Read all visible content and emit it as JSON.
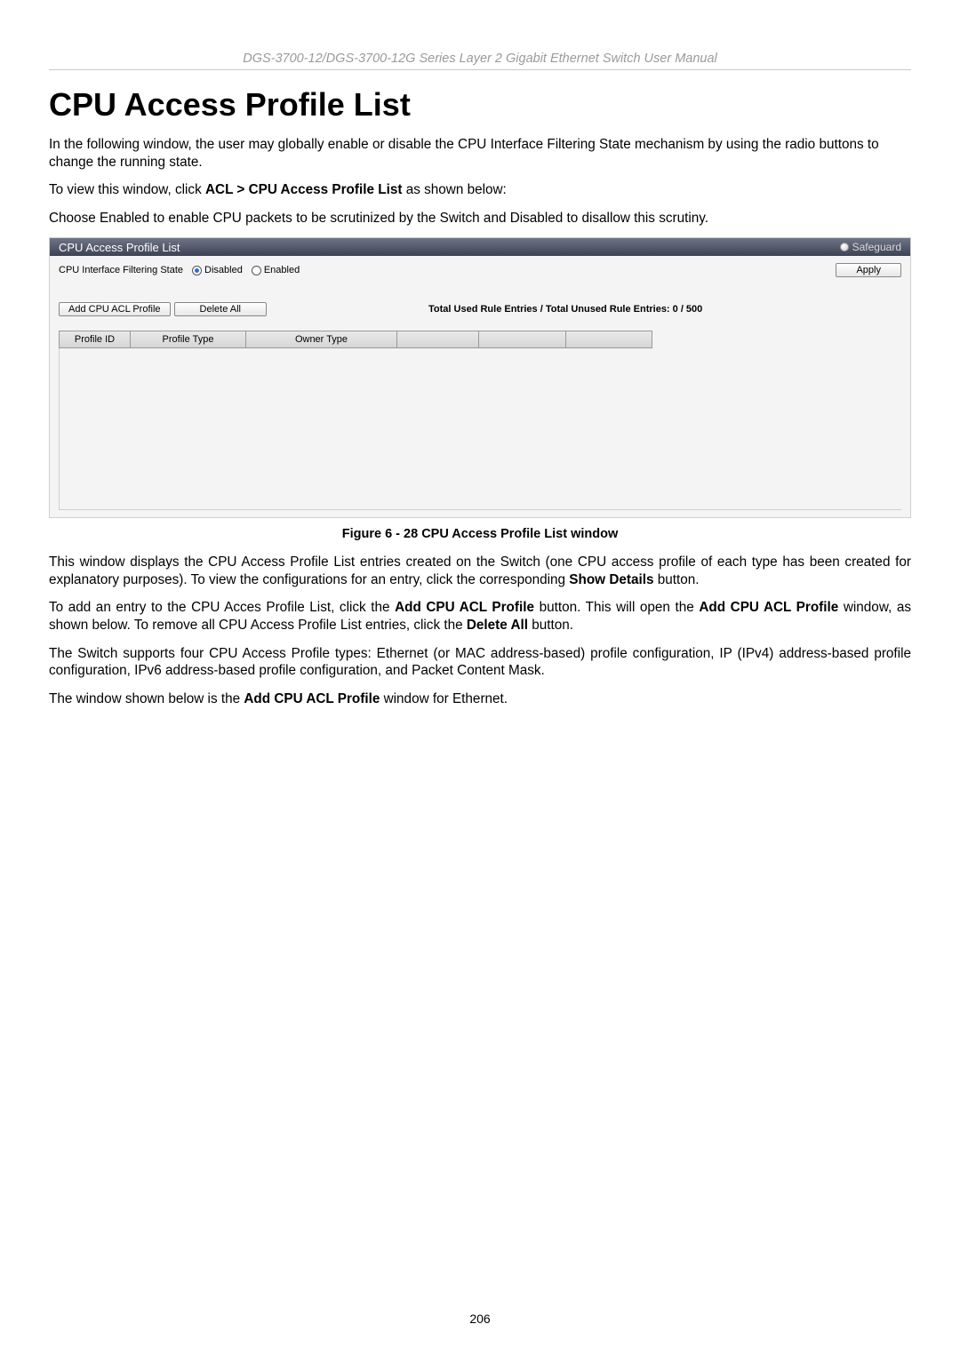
{
  "header": "DGS-3700-12/DGS-3700-12G Series Layer 2 Gigabit Ethernet Switch User Manual",
  "title": "CPU Access Profile List",
  "p1": "In the following window, the user may globally enable or disable the CPU Interface Filtering State mechanism by using the radio buttons to change the running state.",
  "p2_a": "To view this window, click ",
  "p2_b": "ACL > CPU Access Profile List",
  "p2_c": " as shown below:",
  "p3": "Choose Enabled to enable CPU packets to be scrutinized by the Switch and Disabled to disallow this scrutiny.",
  "shot": {
    "title": "CPU Access Profile List",
    "safeguard": "Safeguard",
    "filter_label": "CPU Interface Filtering State",
    "radio_disabled": "Disabled",
    "radio_enabled": "Enabled",
    "apply": "Apply",
    "btn_add": "Add CPU ACL Profile",
    "btn_del": "Delete All",
    "rule_entries": "Total Used Rule Entries / Total Unused Rule Entries: 0 / 500",
    "cols": [
      "Profile ID",
      "Profile Type",
      "Owner Type",
      "",
      "",
      ""
    ]
  },
  "caption": "Figure 6 - 28 CPU Access Profile List window",
  "p4_a": "This window displays the CPU Access Profile List entries created on the Switch (one CPU access profile of each type has been created for explanatory purposes). To view the configurations for an entry, click the corresponding ",
  "p4_b": "Show Details",
  "p4_c": " button.",
  "p5_a": "To add an entry to the CPU Acces Profile List, click the ",
  "p5_b": "Add CPU ACL Profile",
  "p5_c": " button. This will open the ",
  "p5_d": "Add CPU ACL Profile",
  "p5_e": " window, as shown below. To remove all CPU Access Profile List entries, click the ",
  "p5_f": "Delete All",
  "p5_g": " button.",
  "p6": "The Switch supports four CPU Access Profile types: Ethernet (or MAC address-based) profile configuration, IP (IPv4) address-based profile configuration, IPv6 address-based profile configuration, and Packet Content Mask.",
  "p7_a": "The window shown below is the ",
  "p7_b": "Add CPU ACL Profile",
  "p7_c": " window for Ethernet.",
  "page_number": "206"
}
